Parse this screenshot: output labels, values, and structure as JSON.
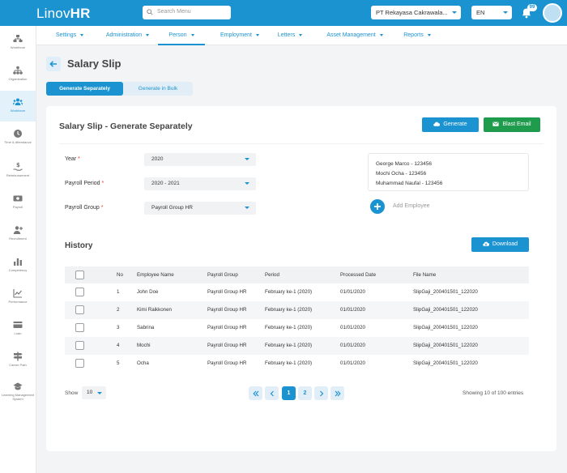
{
  "topbar": {
    "logo_light": "Linov",
    "logo_bold": "HR",
    "search_placeholder": "Search Menu",
    "company": "PT Rekayasa Cakrawala...",
    "language": "EN",
    "notification_count": "99"
  },
  "sidebar": {
    "items": [
      {
        "label": "Workforce",
        "icon": "org-chart-icon"
      },
      {
        "label": "Organization",
        "icon": "hierarchy-icon"
      },
      {
        "label": "Workforce",
        "icon": "people-icon"
      },
      {
        "label": "Time & Attendance",
        "icon": "clock-icon"
      },
      {
        "label": "Reimbursement",
        "icon": "money-hand-icon"
      },
      {
        "label": "Payroll",
        "icon": "payroll-icon"
      },
      {
        "label": "Recruitment",
        "icon": "add-person-icon"
      },
      {
        "label": "Competency",
        "icon": "bar-chart-icon"
      },
      {
        "label": "Performance",
        "icon": "trend-icon"
      },
      {
        "label": "Loan",
        "icon": "card-icon"
      },
      {
        "label": "Career Path",
        "icon": "signpost-icon"
      },
      {
        "label": "Learning Management System",
        "icon": "graduation-icon"
      }
    ]
  },
  "subnav": {
    "items": [
      {
        "label": "Settings"
      },
      {
        "label": "Administration"
      },
      {
        "label": "Person"
      },
      {
        "label": "Employment"
      },
      {
        "label": "Letters"
      },
      {
        "label": "Asset Management"
      },
      {
        "label": "Reports"
      }
    ]
  },
  "page": {
    "title": "Salary Slip",
    "tabs": [
      "Generate Separately",
      "Generate in Bulk"
    ]
  },
  "card": {
    "title": "Salary Slip - Generate Separately",
    "generate_label": "Generate",
    "blast_label": "Blast Email",
    "year_label": "Year",
    "year_value": "2020",
    "period_label": "Payroll Period",
    "period_value": "2020 - 2021",
    "group_label": "Payroll Group",
    "group_value": "Payroll Group HR",
    "required_mark": "*",
    "employees": [
      "George Marco - 123456",
      "Mochi Ocha - 123456",
      "Muhammad Naufal - 123456"
    ],
    "add_employee_label": "Add Employee",
    "history_title": "History",
    "download_label": "Download"
  },
  "table": {
    "headers": [
      "No",
      "Employee Name",
      "Payroll Group",
      "Period",
      "Processed Date",
      "File Name"
    ],
    "rows": [
      [
        "1",
        "John Doe",
        "Payroll Group HR",
        "February ke-1 (2020)",
        "01/01/2020",
        "SlipGaji_200401501_122020"
      ],
      [
        "2",
        "Kimi Raikkonen",
        "Payroll Group HR",
        "February ke-1 (2020)",
        "01/01/2020",
        "SlipGaji_200401501_122020"
      ],
      [
        "3",
        "Sabrina",
        "Payroll Group HR",
        "February ke-1 (2020)",
        "01/01/2020",
        "SlipGaji_200401501_122020"
      ],
      [
        "4",
        "Mochi",
        "Payroll Group HR",
        "February ke-1 (2020)",
        "01/01/2020",
        "SlipGaji_200401501_122020"
      ],
      [
        "5",
        "Ocha",
        "Payroll Group HR",
        "February ke-1 (2020)",
        "01/01/2020",
        "SlipGaji_200401501_122020"
      ]
    ]
  },
  "pagination": {
    "show_label": "Show",
    "page_size": "10",
    "pages": [
      "1",
      "2"
    ],
    "current_page": "1",
    "entries_text": "Showing 10 of 100 entries"
  },
  "colors": {
    "primary": "#1c93d1",
    "success": "#1f9b4e",
    "required": "#e53935"
  }
}
